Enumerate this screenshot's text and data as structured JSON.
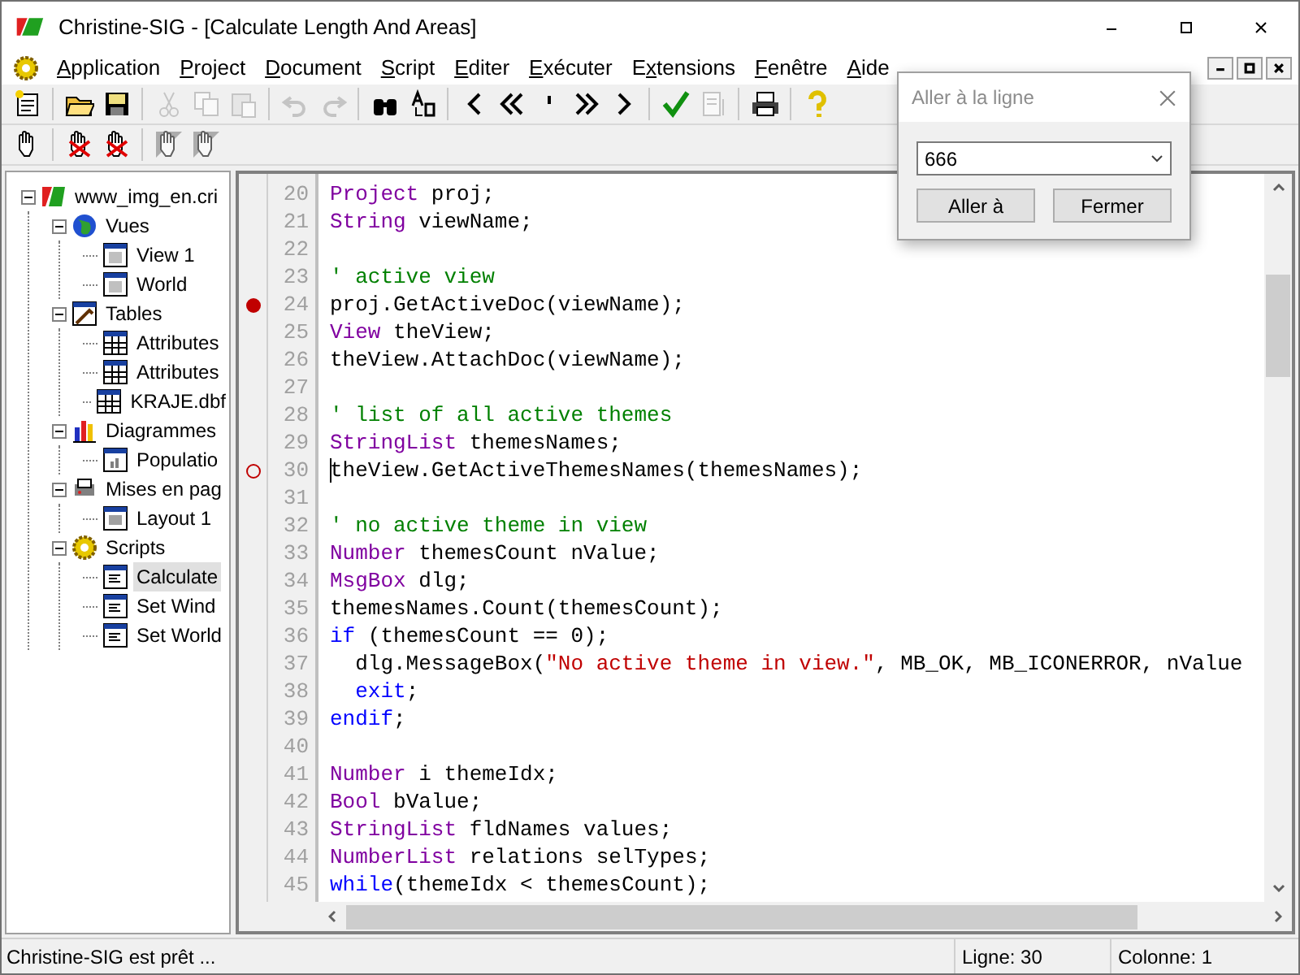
{
  "window": {
    "title": "Christine-SIG - [Calculate Length And Areas]"
  },
  "menu": [
    {
      "key": "A",
      "after": "pplication"
    },
    {
      "key": "P",
      "after": "roject"
    },
    {
      "key": "D",
      "after": "ocument"
    },
    {
      "key": "S",
      "after": "cript"
    },
    {
      "key": "E",
      "after": "diter"
    },
    {
      "key": "E",
      "after": "xécuter"
    },
    {
      "before": "E",
      "key": "x",
      "after": "tensions"
    },
    {
      "key": "F",
      "after": "enêtre"
    },
    {
      "key": "A",
      "after": "ide"
    }
  ],
  "toolbar": [
    {
      "kind": "new",
      "disabled": false
    },
    {
      "kind": "sep"
    },
    {
      "kind": "open",
      "disabled": false
    },
    {
      "kind": "save",
      "disabled": false
    },
    {
      "kind": "sep"
    },
    {
      "kind": "cut",
      "disabled": true
    },
    {
      "kind": "copy",
      "disabled": true
    },
    {
      "kind": "paste",
      "disabled": true
    },
    {
      "kind": "sep"
    },
    {
      "kind": "undo",
      "disabled": true
    },
    {
      "kind": "redo",
      "disabled": true
    },
    {
      "kind": "sep"
    },
    {
      "kind": "find",
      "disabled": false
    },
    {
      "kind": "replace",
      "disabled": false
    },
    {
      "kind": "sep"
    },
    {
      "kind": "prev",
      "disabled": false
    },
    {
      "kind": "first",
      "disabled": false
    },
    {
      "kind": "mark",
      "disabled": false
    },
    {
      "kind": "last",
      "disabled": false
    },
    {
      "kind": "next",
      "disabled": false
    },
    {
      "kind": "sep"
    },
    {
      "kind": "check",
      "disabled": false
    },
    {
      "kind": "list",
      "disabled": true
    },
    {
      "kind": "sep"
    },
    {
      "kind": "print",
      "disabled": false
    },
    {
      "kind": "sep"
    },
    {
      "kind": "help",
      "disabled": false
    }
  ],
  "toolbar2": [
    {
      "kind": "hand",
      "disabled": false
    },
    {
      "kind": "sep"
    },
    {
      "kind": "hand-x",
      "disabled": false
    },
    {
      "kind": "hand-xx",
      "disabled": false
    },
    {
      "kind": "sep"
    },
    {
      "kind": "hand-grey",
      "disabled": true
    },
    {
      "kind": "hand-grey2",
      "disabled": true
    }
  ],
  "tree": [
    {
      "label": "www_img_en.cri",
      "kind": "project",
      "expanded": true,
      "selected": false,
      "children": [
        {
          "label": "Vues",
          "kind": "views",
          "expanded": true,
          "selected": false,
          "children": [
            {
              "label": "View 1",
              "kind": "view",
              "selected": false
            },
            {
              "label": "World",
              "kind": "view",
              "selected": false
            }
          ]
        },
        {
          "label": "Tables",
          "kind": "tables",
          "expanded": true,
          "selected": false,
          "children": [
            {
              "label": "Attributes",
              "kind": "table",
              "selected": false
            },
            {
              "label": "Attributes",
              "kind": "table",
              "selected": false
            },
            {
              "label": "KRAJE.dbf",
              "kind": "table",
              "selected": false
            }
          ]
        },
        {
          "label": "Diagrammes",
          "kind": "charts",
          "expanded": true,
          "selected": false,
          "children": [
            {
              "label": "Populatio",
              "kind": "chart",
              "selected": false
            }
          ]
        },
        {
          "label": "Mises en pag",
          "kind": "layouts",
          "expanded": true,
          "selected": false,
          "children": [
            {
              "label": "Layout 1",
              "kind": "layout",
              "selected": false
            }
          ]
        },
        {
          "label": "Scripts",
          "kind": "scripts",
          "expanded": true,
          "selected": false,
          "children": [
            {
              "label": "Calculate",
              "kind": "script",
              "selected": true
            },
            {
              "label": "Set Wind",
              "kind": "script",
              "selected": false
            },
            {
              "label": "Set World",
              "kind": "script",
              "selected": false
            }
          ]
        }
      ]
    }
  ],
  "editor": {
    "lines": [
      {
        "number": "20",
        "caret": false,
        "tokens": [
          {
            "kind": "type",
            "text": "Project"
          },
          {
            "kind": "plain",
            "text": " proj;"
          }
        ]
      },
      {
        "number": "21",
        "caret": false,
        "tokens": [
          {
            "kind": "type",
            "text": "String"
          },
          {
            "kind": "plain",
            "text": " viewName;"
          }
        ]
      },
      {
        "number": "22",
        "caret": false
      },
      {
        "number": "23",
        "caret": false,
        "tokens": [
          {
            "kind": "comment",
            "text": "' active view"
          }
        ]
      },
      {
        "number": "24",
        "caret": false,
        "breakpoint": true,
        "enabled": true,
        "tokens": [
          {
            "kind": "plain",
            "text": "proj.GetActiveDoc(viewName);"
          }
        ]
      },
      {
        "number": "25",
        "caret": false,
        "tokens": [
          {
            "kind": "type",
            "text": "View"
          },
          {
            "kind": "plain",
            "text": " theView;"
          }
        ]
      },
      {
        "number": "26",
        "caret": false,
        "tokens": [
          {
            "kind": "plain",
            "text": "theView.AttachDoc(viewName);"
          }
        ]
      },
      {
        "number": "27",
        "caret": false
      },
      {
        "number": "28",
        "caret": false,
        "tokens": [
          {
            "kind": "comment",
            "text": "' list of all active themes"
          }
        ]
      },
      {
        "number": "29",
        "caret": false,
        "tokens": [
          {
            "kind": "type",
            "text": "StringList"
          },
          {
            "kind": "plain",
            "text": " themesNames;"
          }
        ]
      },
      {
        "number": "30",
        "caret": true,
        "breakpoint": true,
        "enabled": false,
        "tokens": [
          {
            "kind": "plain",
            "text": "theView.GetActiveThemesNames(themesNames);"
          }
        ]
      },
      {
        "number": "31",
        "caret": false
      },
      {
        "number": "32",
        "caret": false,
        "tokens": [
          {
            "kind": "comment",
            "text": "' no active theme in view"
          }
        ]
      },
      {
        "number": "33",
        "caret": false,
        "tokens": [
          {
            "kind": "type",
            "text": "Number"
          },
          {
            "kind": "plain",
            "text": " themesCount nValue;"
          }
        ]
      },
      {
        "number": "34",
        "caret": false,
        "tokens": [
          {
            "kind": "type",
            "text": "MsgBox"
          },
          {
            "kind": "plain",
            "text": " dlg;"
          }
        ]
      },
      {
        "number": "35",
        "caret": false,
        "tokens": [
          {
            "kind": "plain",
            "text": "themesNames.Count(themesCount);"
          }
        ]
      },
      {
        "number": "36",
        "caret": false,
        "tokens": [
          {
            "kind": "keyword",
            "text": "if"
          },
          {
            "kind": "plain",
            "text": " (themesCount == 0);"
          }
        ]
      },
      {
        "number": "37",
        "caret": false,
        "tokens": [
          {
            "kind": "plain",
            "text": "  dlg.MessageBox("
          },
          {
            "kind": "string",
            "text": "\"No active theme in view.\""
          },
          {
            "kind": "plain",
            "text": ", MB_OK, MB_ICONERROR, nValue"
          }
        ]
      },
      {
        "number": "38",
        "caret": false,
        "tokens": [
          {
            "kind": "keyword",
            "text": "  exit"
          },
          {
            "kind": "plain",
            "text": ";"
          }
        ]
      },
      {
        "number": "39",
        "caret": false,
        "tokens": [
          {
            "kind": "keyword",
            "text": "endif"
          },
          {
            "kind": "plain",
            "text": ";"
          }
        ]
      },
      {
        "number": "40",
        "caret": false
      },
      {
        "number": "41",
        "caret": false,
        "tokens": [
          {
            "kind": "type",
            "text": "Number"
          },
          {
            "kind": "plain",
            "text": " i themeIdx;"
          }
        ]
      },
      {
        "number": "42",
        "caret": false,
        "tokens": [
          {
            "kind": "type",
            "text": "Bool"
          },
          {
            "kind": "plain",
            "text": " bValue;"
          }
        ]
      },
      {
        "number": "43",
        "caret": false,
        "tokens": [
          {
            "kind": "type",
            "text": "StringList"
          },
          {
            "kind": "plain",
            "text": " fldNames values;"
          }
        ]
      },
      {
        "number": "44",
        "caret": false,
        "tokens": [
          {
            "kind": "type",
            "text": "NumberList"
          },
          {
            "kind": "plain",
            "text": " relations selTypes;"
          }
        ]
      },
      {
        "number": "45",
        "caret": false,
        "tokens": [
          {
            "kind": "keyword",
            "text": "while"
          },
          {
            "kind": "plain",
            "text": "(themeIdx < themesCount);"
          }
        ]
      }
    ]
  },
  "dialog": {
    "title": "Aller à la ligne",
    "active": false,
    "value": "666",
    "buttons": [
      "Aller à",
      "Fermer"
    ]
  },
  "status_bar": {
    "message": "Christine-SIG est prêt ...",
    "line": "Ligne: 30",
    "column": "Colonne: 1"
  }
}
